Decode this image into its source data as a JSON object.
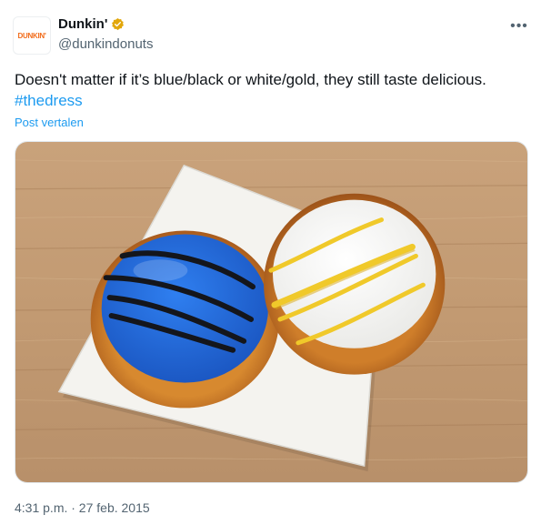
{
  "author": {
    "display_name": "Dunkin'",
    "handle": "@dunkindonuts",
    "avatar_text": "DUNKIN'",
    "verified": true,
    "verified_color": "#e2a70b"
  },
  "tweet": {
    "text": "Doesn't matter if it’s blue/black or white/gold, they still taste delicious.",
    "hashtag": "#thedress",
    "translate_label": "Post vertalen",
    "more_icon": "more-horizontal-icon"
  },
  "media": {
    "subject": "photo of two donuts on a white square plate"
  },
  "meta": {
    "timestamp": "4:31 p.m. · 27 feb. 2015"
  },
  "colors": {
    "link": "#1d9bf0",
    "secondary_text": "#536471",
    "brand_orange": "#f26c1b"
  }
}
